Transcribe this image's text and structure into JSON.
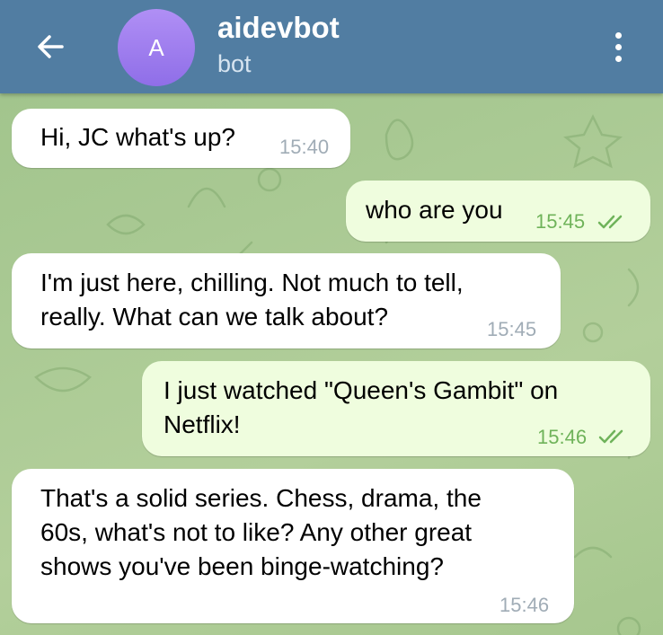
{
  "header": {
    "back_icon": "arrow-left-icon",
    "avatar_letter": "A",
    "title": "aidevbot",
    "subtitle": "bot",
    "menu_icon": "more-vertical-icon"
  },
  "colors": {
    "header_bg": "#517da2",
    "incoming_bubble": "#ffffff",
    "outgoing_bubble": "#effdde",
    "outgoing_time": "#6fb35a",
    "incoming_time": "#a0acb6",
    "avatar": "#9b7bef"
  },
  "messages": [
    {
      "direction": "incoming",
      "lines": [
        "Hi, JC what's up?"
      ],
      "time": "15:40"
    },
    {
      "direction": "outgoing",
      "lines": [
        "who are you"
      ],
      "time": "15:45",
      "status_icon": "double-check-icon"
    },
    {
      "direction": "incoming",
      "lines": [
        "I'm just here, chilling. Not much to tell,",
        "really. What can we talk about?"
      ],
      "time": "15:45"
    },
    {
      "direction": "outgoing",
      "lines": [
        "I just watched \"Queen's Gambit\" on",
        "Netflix!"
      ],
      "time": "15:46",
      "status_icon": "double-check-icon"
    },
    {
      "direction": "incoming",
      "lines": [
        "That's a solid series. Chess, drama, the",
        "60s, what's not to like? Any other great",
        "shows you've been binge-watching?"
      ],
      "time": "15:46"
    }
  ]
}
